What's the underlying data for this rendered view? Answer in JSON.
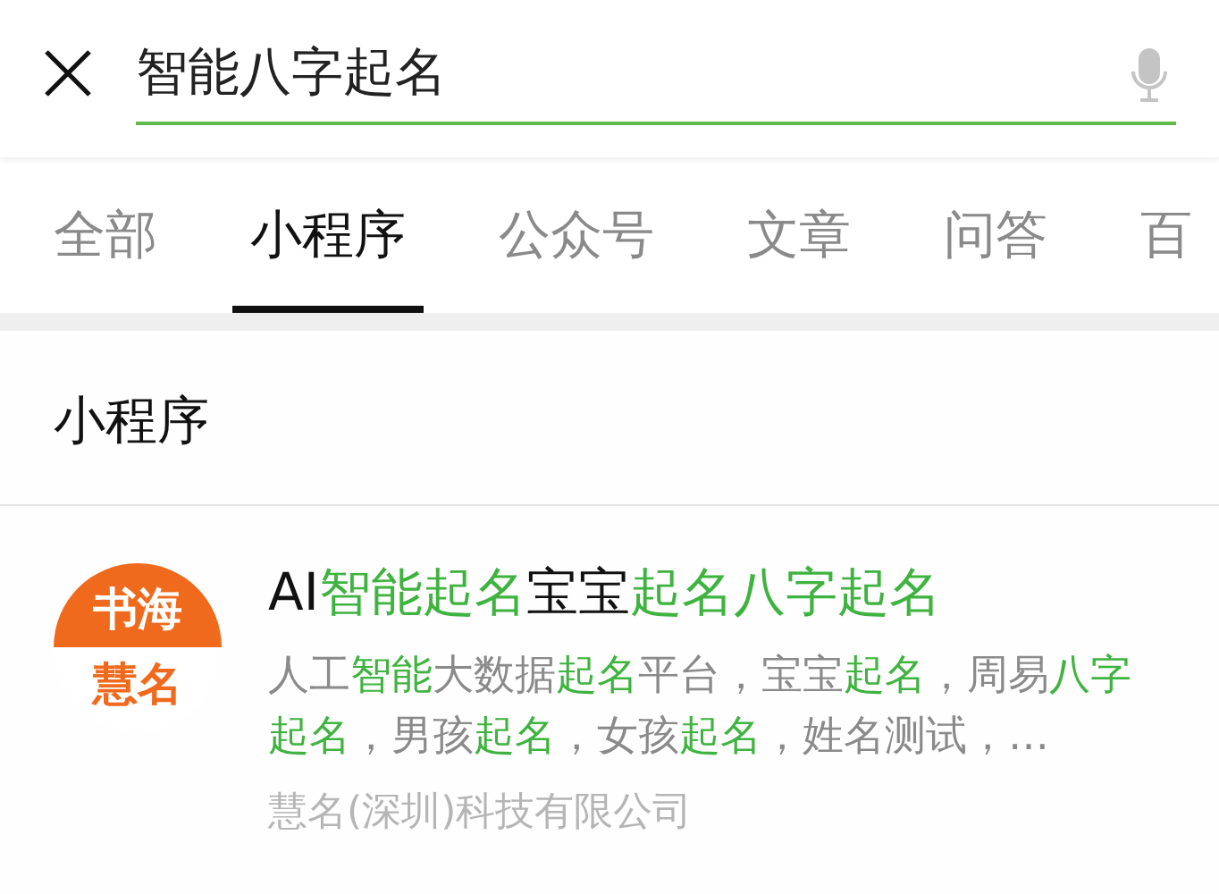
{
  "search": {
    "value": "智能八字起名"
  },
  "tabs": [
    {
      "label": "全部",
      "selected": false
    },
    {
      "label": "小程序",
      "selected": true
    },
    {
      "label": "公众号",
      "selected": false
    },
    {
      "label": "文章",
      "selected": false
    },
    {
      "label": "问答",
      "selected": false
    },
    {
      "label": "百",
      "selected": false
    }
  ],
  "section": {
    "title": "小程序"
  },
  "results": [
    {
      "logo": {
        "top": "书海",
        "bottom": "慧名"
      },
      "title": "AI**智能起名**宝宝**起名八字起名**",
      "description": "人工**智能**大数据**起名**平台，宝宝**起名**，周易**八字起名**，男孩**起名**，女孩**起名**，姓名测试，…",
      "company": "慧名(深圳)科技有限公司"
    }
  ]
}
